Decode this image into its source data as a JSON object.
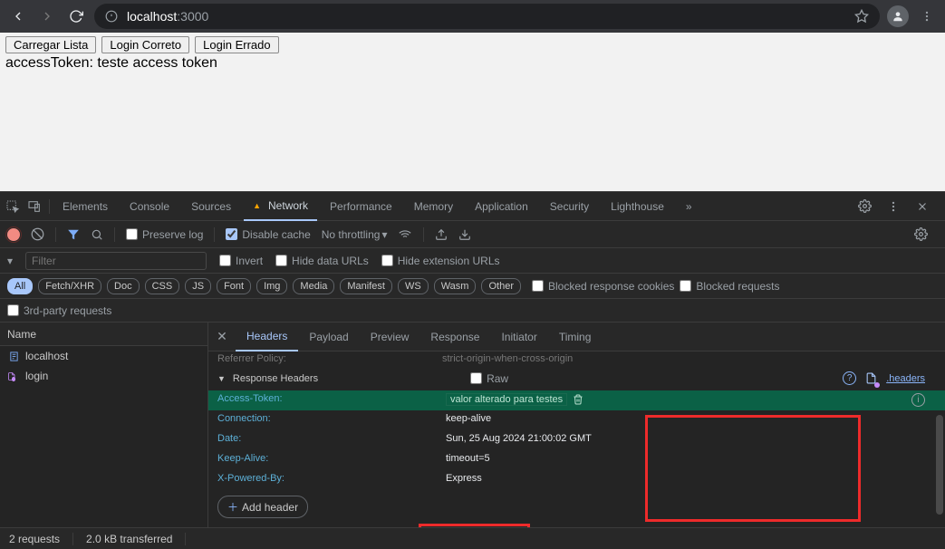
{
  "browser": {
    "url_host": "localhost",
    "url_port": ":3000"
  },
  "page": {
    "buttons": [
      "Carregar Lista",
      "Login Correto",
      "Login Errado"
    ],
    "body_text": "accessToken: teste access token"
  },
  "devtools": {
    "tabs": [
      "Elements",
      "Console",
      "Sources",
      "Network",
      "Performance",
      "Memory",
      "Application",
      "Security",
      "Lighthouse"
    ],
    "more_icon": "»",
    "toolbar": {
      "preserve_log": "Preserve log",
      "disable_cache": "Disable cache",
      "throttling": "No throttling"
    },
    "filter": {
      "placeholder": "Filter",
      "invert": "Invert",
      "hide_data": "Hide data URLs",
      "hide_ext": "Hide extension URLs"
    },
    "types": [
      "All",
      "Fetch/XHR",
      "Doc",
      "CSS",
      "JS",
      "Font",
      "Img",
      "Media",
      "Manifest",
      "WS",
      "Wasm",
      "Other"
    ],
    "blocked_cookies": "Blocked response cookies",
    "blocked_requests": "Blocked requests",
    "third_party": "3rd-party requests",
    "name_col": "Name",
    "requests": [
      {
        "label": "localhost",
        "selected": false
      },
      {
        "label": "login",
        "selected": true
      }
    ],
    "detail_tabs": [
      "Headers",
      "Payload",
      "Preview",
      "Response",
      "Initiator",
      "Timing"
    ],
    "ghost_left": "Referrer Policy:",
    "ghost_right": "strict-origin-when-cross-origin",
    "section_title": "Response Headers",
    "raw": "Raw",
    "headers_link": ".headers",
    "headers": [
      {
        "name": "Access-Token:",
        "value": "valor alterado para testes",
        "override": true
      },
      {
        "name": "Connection:",
        "value": "keep-alive",
        "override": false
      },
      {
        "name": "Date:",
        "value": "Sun, 25 Aug 2024 21:00:02 GMT",
        "override": false
      },
      {
        "name": "Keep-Alive:",
        "value": "timeout=5",
        "override": false
      },
      {
        "name": "X-Powered-By:",
        "value": "Express",
        "override": false
      }
    ],
    "add_header": "Add header",
    "status": {
      "requests": "2 requests",
      "transferred": "2.0 kB transferred"
    }
  }
}
